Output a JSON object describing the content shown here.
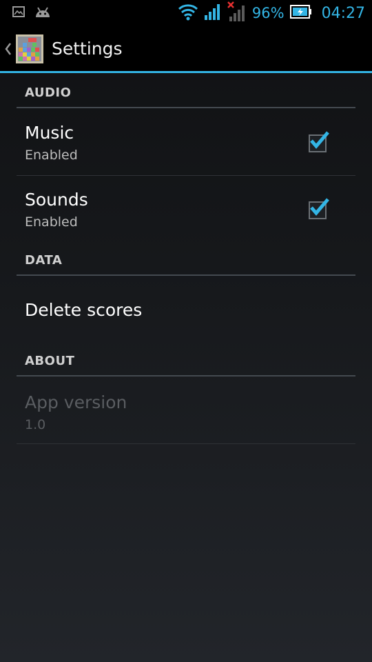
{
  "status_bar": {
    "battery_percent": "96%",
    "time": "04:27",
    "accent": "#33b5e5",
    "icons": [
      "image-notification-icon",
      "android-notification-icon",
      "wifi-icon",
      "signal-icon",
      "no-signal-icon",
      "battery-charging-icon"
    ]
  },
  "action_bar": {
    "title": "Settings",
    "icons": [
      "up-caret-icon",
      "app-icon"
    ]
  },
  "sections": {
    "audio": {
      "header": "AUDIO",
      "music": {
        "title": "Music",
        "summary": "Enabled",
        "checked": true
      },
      "sounds": {
        "title": "Sounds",
        "summary": "Enabled",
        "checked": true
      }
    },
    "data": {
      "header": "DATA",
      "delete_scores": {
        "title": "Delete scores"
      }
    },
    "about": {
      "header": "ABOUT",
      "app_version": {
        "title": "App version",
        "summary": "1.0",
        "enabled": false
      }
    }
  }
}
